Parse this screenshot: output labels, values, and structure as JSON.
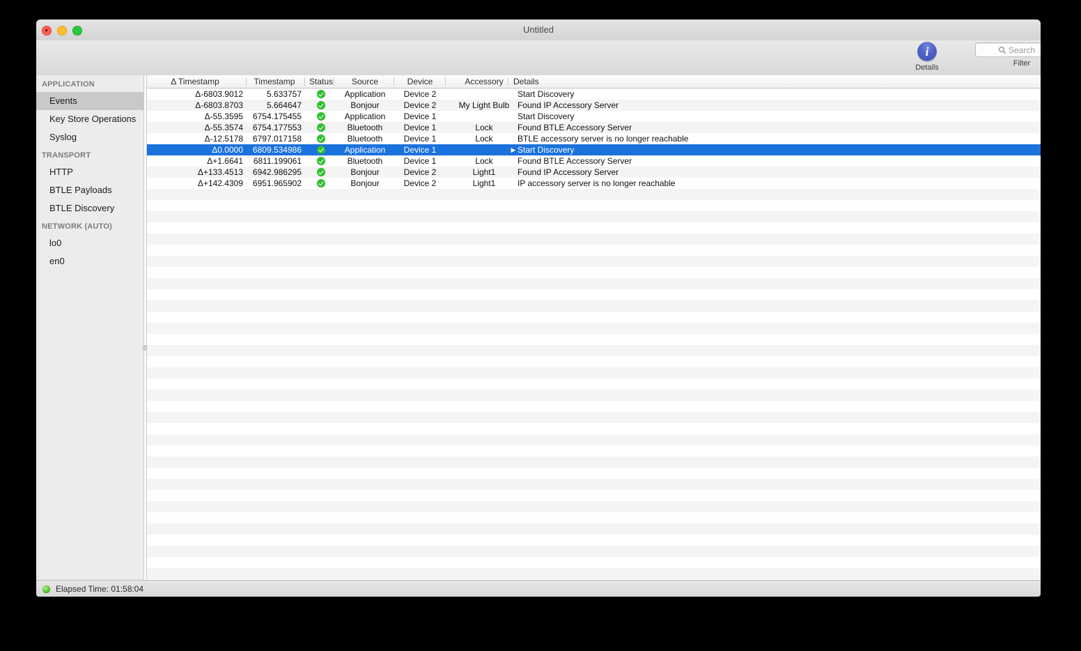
{
  "window": {
    "title": "Untitled",
    "controls": {
      "close": "close-button",
      "minimize": "minimize-button",
      "maximize": "maximize-button"
    }
  },
  "toolbar": {
    "details_label": "Details",
    "details_icon_glyph": "i",
    "filter_label": "Filter",
    "search_placeholder": "Search",
    "search_value": ""
  },
  "sidebar": {
    "groups": [
      {
        "header": "APPLICATION",
        "items": [
          {
            "label": "Events",
            "selected": true
          },
          {
            "label": "Key Store Operations",
            "selected": false
          },
          {
            "label": "Syslog",
            "selected": false
          }
        ]
      },
      {
        "header": "TRANSPORT",
        "items": [
          {
            "label": "HTTP",
            "selected": false
          },
          {
            "label": "BTLE Payloads",
            "selected": false
          },
          {
            "label": "BTLE Discovery",
            "selected": false
          }
        ]
      },
      {
        "header": "NETWORK (AUTO)",
        "items": [
          {
            "label": "lo0",
            "selected": false
          },
          {
            "label": "en0",
            "selected": false
          }
        ]
      }
    ]
  },
  "table": {
    "columns": [
      {
        "key": "delta_timestamp",
        "label": "Δ Timestamp"
      },
      {
        "key": "timestamp",
        "label": "Timestamp"
      },
      {
        "key": "status",
        "label": "Status"
      },
      {
        "key": "source",
        "label": "Source"
      },
      {
        "key": "device",
        "label": "Device"
      },
      {
        "key": "accessory",
        "label": "Accessory"
      },
      {
        "key": "details",
        "label": "Details"
      }
    ],
    "rows": [
      {
        "delta_timestamp": "Δ-6803.9012",
        "timestamp": "5.633757",
        "status": "ok",
        "source": "Application",
        "device": "Device 2",
        "accessory": "",
        "details": "Start Discovery",
        "selected": false,
        "disclosure": false
      },
      {
        "delta_timestamp": "Δ-6803.8703",
        "timestamp": "5.664647",
        "status": "ok",
        "source": "Bonjour",
        "device": "Device 2",
        "accessory": "My Light Bulb",
        "details": "Found IP Accessory Server",
        "selected": false,
        "disclosure": false
      },
      {
        "delta_timestamp": "Δ-55.3595",
        "timestamp": "6754.175455",
        "status": "ok",
        "source": "Application",
        "device": "Device 1",
        "accessory": "",
        "details": "Start Discovery",
        "selected": false,
        "disclosure": false
      },
      {
        "delta_timestamp": "Δ-55.3574",
        "timestamp": "6754.177553",
        "status": "ok",
        "source": "Bluetooth",
        "device": "Device 1",
        "accessory": "Lock",
        "details": "Found BTLE Accessory Server",
        "selected": false,
        "disclosure": false
      },
      {
        "delta_timestamp": "Δ-12.5178",
        "timestamp": "6797.017158",
        "status": "ok",
        "source": "Bluetooth",
        "device": "Device 1",
        "accessory": "Lock",
        "details": "BTLE accessory server is no longer reachable",
        "selected": false,
        "disclosure": false
      },
      {
        "delta_timestamp": "Δ0.0000",
        "timestamp": "6809.534986",
        "status": "ok",
        "source": "Application",
        "device": "Device 1",
        "accessory": "",
        "details": "Start Discovery",
        "selected": true,
        "disclosure": true
      },
      {
        "delta_timestamp": "Δ+1.6641",
        "timestamp": "6811.199061",
        "status": "ok",
        "source": "Bluetooth",
        "device": "Device 1",
        "accessory": "Lock",
        "details": "Found BTLE Accessory Server",
        "selected": false,
        "disclosure": false
      },
      {
        "delta_timestamp": "Δ+133.4513",
        "timestamp": "6942.986295",
        "status": "ok",
        "source": "Bonjour",
        "device": "Device 2",
        "accessory": "Light1",
        "details": "Found IP Accessory Server",
        "selected": false,
        "disclosure": false
      },
      {
        "delta_timestamp": "Δ+142.4309",
        "timestamp": "6951.965902",
        "status": "ok",
        "source": "Bonjour",
        "device": "Device 2",
        "accessory": "Light1",
        "details": "IP accessory server is no longer reachable",
        "selected": false,
        "disclosure": false
      }
    ],
    "empty_row_count": 41,
    "disclosure_glyph": "▶"
  },
  "statusbar": {
    "indicator": "running",
    "text": "Elapsed Time: 01:58:04"
  },
  "colors": {
    "selection_blue": "#1a72dd",
    "status_green": "#2fc12f",
    "details_icon_blue": "#4f62c8",
    "window_chrome": "#ececec",
    "row_stripe": "#f4f4f4"
  }
}
